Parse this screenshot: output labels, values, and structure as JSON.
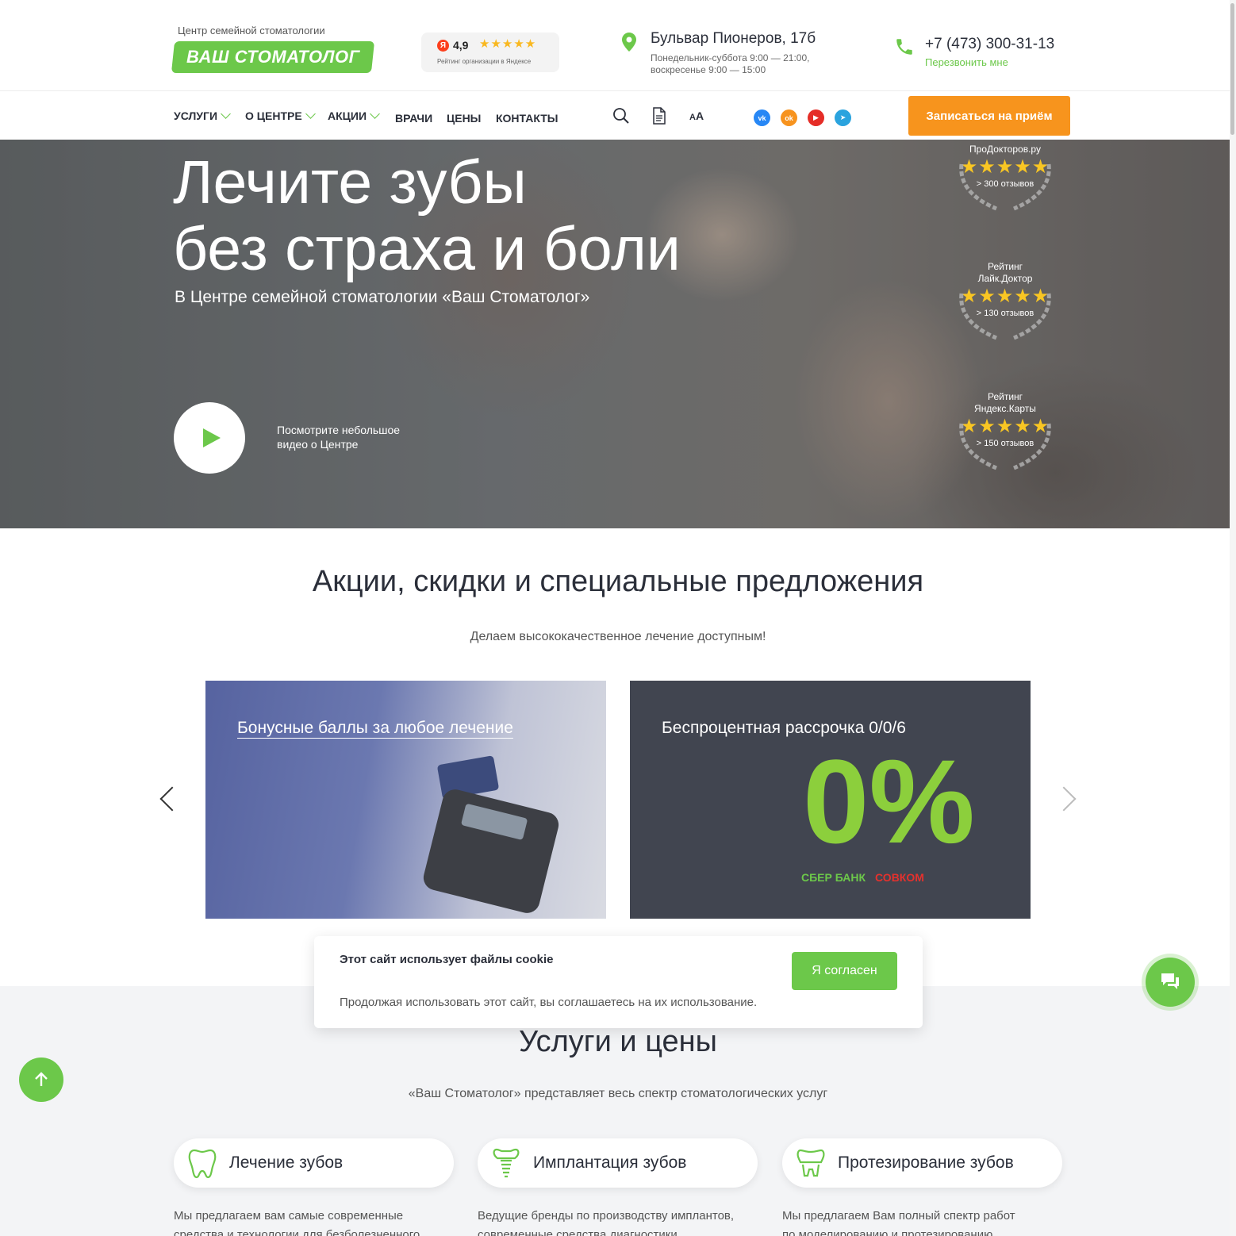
{
  "header": {
    "logo_subtitle": "Центр семейной стоматологии",
    "logo_text": "ВАШ СТОМАТОЛОГ",
    "yandex": {
      "badge": "Я",
      "score": "4,9",
      "stars": "★★★★★",
      "caption": "Рейтинг организации в Яндексе"
    },
    "address": "Бульвар Пионеров, 17б",
    "hours_line1": "Понедельник-суббота 9:00 — 21:00,",
    "hours_line2": "воскресенье 9:00 — 15:00",
    "phone": "+7 (473) 300-31-13",
    "callback": "Перезвонить мне"
  },
  "nav": {
    "items": [
      "УСЛУГИ",
      "О ЦЕНТРЕ",
      "АКЦИИ",
      "ВРАЧИ",
      "ЦЕНЫ",
      "КОНТАКТЫ"
    ],
    "font_size_label_small": "A",
    "font_size_label_large": "A",
    "social": [
      "vk-icon",
      "odnoklassniki-icon",
      "youtube-icon",
      "telegram-icon"
    ],
    "cta": "Записаться на приём"
  },
  "hero": {
    "title_line1": "Лечите зубы",
    "title_line2": "без страха и боли",
    "subtitle": "В Центре семейной стоматологии «Ваш Стоматолог»",
    "video_caption_line1": "Посмотрите небольшое",
    "video_caption_line2": "видео о Центре",
    "ratings": [
      {
        "title_line1": "ПроДокторов.ру",
        "title_line2": "",
        "stars": "★★★★★",
        "count": "> 300 отзывов"
      },
      {
        "title_line1": "Рейтинг",
        "title_line2": "Лайк.Доктор",
        "stars": "★★★★★",
        "count": "> 130 отзывов"
      },
      {
        "title_line1": "Рейтинг",
        "title_line2": "Яндекс.Карты",
        "stars": "★★★★★",
        "count": "> 150 отзывов"
      }
    ]
  },
  "promos": {
    "heading": "Акции, скидки и специальные предложения",
    "subheading": "Делаем высококачественное лечение доступным!",
    "cards": [
      {
        "title": "Бонусные баллы за любое лечение"
      },
      {
        "title": "Беспроцентная рассрочка 0/0/6",
        "big_text": "0%",
        "bank1": "СБЕР БАНК",
        "bank2": "СОВКОМ"
      }
    ]
  },
  "cookie": {
    "title": "Этот сайт использует файлы cookie",
    "text": "Продолжая использовать этот сайт, вы соглашаетесь на их использование.",
    "button": "Я согласен"
  },
  "services": {
    "heading": "Услуги и цены",
    "subheading": "«Ваш Стоматолог» представляет весь спектр стоматологических услуг",
    "items": [
      {
        "name": "Лечение зубов",
        "desc_line1": "Мы предлагаем вам самые современные",
        "desc_line2": "средства и технологии для безболезненного"
      },
      {
        "name": "Имплантация зубов",
        "desc_line1": "Ведущие бренды по производству имплантов,",
        "desc_line2": "современные средства диагностики"
      },
      {
        "name": "Протезирование зубов",
        "desc_line1": "Мы предлагаем Вам полный спектр работ",
        "desc_line2": "по моделированию и протезированию"
      }
    ]
  },
  "colors": {
    "accent": "#6cc84a",
    "cta": "#f7941d",
    "text": "#2b2f3a"
  }
}
